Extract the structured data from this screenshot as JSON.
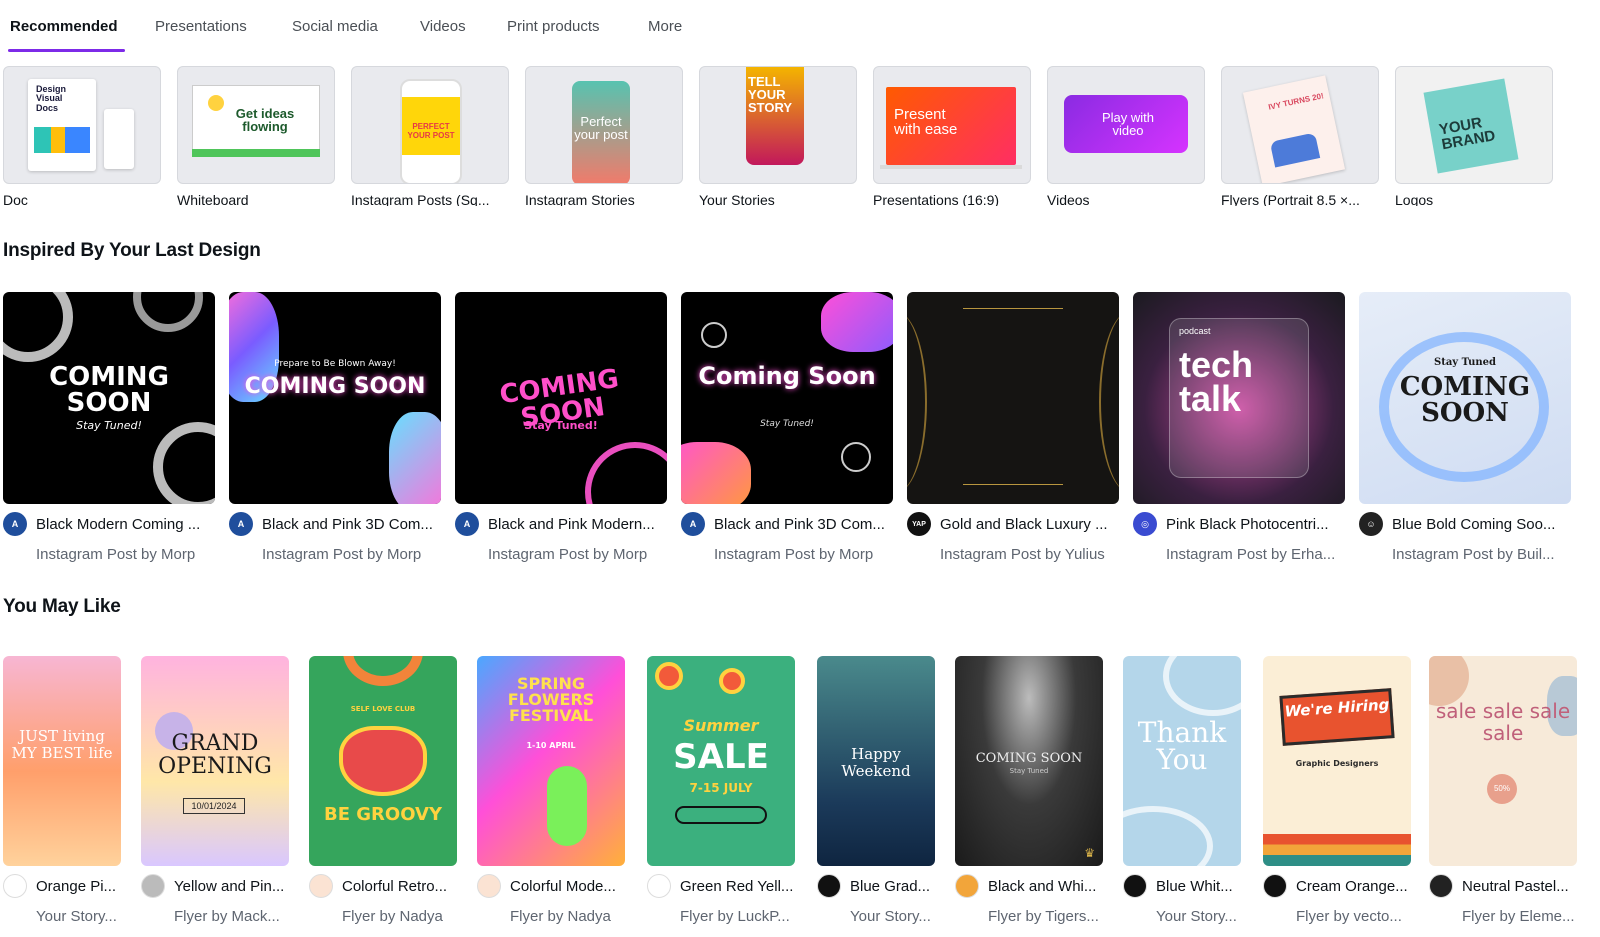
{
  "tabs": [
    {
      "label": "Recommended",
      "active": true
    },
    {
      "label": "Presentations"
    },
    {
      "label": "Social media"
    },
    {
      "label": "Videos"
    },
    {
      "label": "Print products"
    },
    {
      "label": "More"
    }
  ],
  "design_types": [
    {
      "label": "Doc",
      "thumb_text": "Design Visual Docs"
    },
    {
      "label": "Whiteboard",
      "thumb_text": "Get ideas flowing"
    },
    {
      "label": "Instagram Posts (Sq...",
      "thumb_text": "PERFECT YOUR POST"
    },
    {
      "label": "Instagram Stories",
      "thumb_text": "Perfect your post"
    },
    {
      "label": "Your Stories",
      "thumb_text": "TELL YOUR STORY"
    },
    {
      "label": "Presentations (16:9)",
      "thumb_text": "Present with ease"
    },
    {
      "label": "Videos",
      "thumb_text": "Play with video"
    },
    {
      "label": "Flyers (Portrait 8.5 ×...",
      "thumb_text": "IVY TURNS 20!"
    },
    {
      "label": "Logos",
      "thumb_text": "YOUR BRAND"
    }
  ],
  "inspired": {
    "title": "Inspired By Your Last Design",
    "items": [
      {
        "title": "Black Modern Coming ...",
        "sub": "Instagram Post by Morp",
        "thumb_text": "COMING SOON",
        "thumb_sub": "Stay Tuned!",
        "avatar": "A",
        "avatar_color": "#1f4e9c"
      },
      {
        "title": "Black and Pink 3D Com...",
        "sub": "Instagram Post by Morp",
        "thumb_text": "COMING SOON",
        "thumb_sub": "Prepare to Be Blown Away!",
        "avatar": "A",
        "avatar_color": "#1f4e9c"
      },
      {
        "title": "Black and Pink Modern...",
        "sub": "Instagram Post by Morp",
        "thumb_text": "COMING SOON",
        "thumb_sub": "Stay Tuned!",
        "avatar": "A",
        "avatar_color": "#1f4e9c"
      },
      {
        "title": "Black and Pink 3D Com...",
        "sub": "Instagram Post by Morp",
        "thumb_text": "Coming Soon",
        "thumb_sub": "Stay Tuned!",
        "avatar": "A",
        "avatar_color": "#1f4e9c"
      },
      {
        "title": "Gold and Black Luxury ...",
        "sub": "Instagram Post by Yulius",
        "thumb_text": "",
        "thumb_sub": "",
        "avatar": "YAP",
        "avatar_color": "#111111"
      },
      {
        "title": "Pink Black Photocentri...",
        "sub": "Instagram Post by Erha...",
        "thumb_text": "tech talk",
        "thumb_sub": "podcast",
        "avatar": "◎",
        "avatar_color": "#3a4bd1"
      },
      {
        "title": "Blue Bold Coming Soo...",
        "sub": "Instagram Post by Buil...",
        "thumb_text": "COMING SOON",
        "thumb_sub": "Stay Tuned",
        "avatar": "☺",
        "avatar_color": "#222222"
      }
    ]
  },
  "may_like": {
    "title": "You May Like",
    "items": [
      {
        "title": "Orange Pi...",
        "sub": "Your Story...",
        "thumb_text": "JUST living MY BEST life"
      },
      {
        "title": "Yellow and Pin...",
        "sub": "Flyer by Mack...",
        "thumb_text": "GRAND OPENING",
        "thumb_sub": "10/01/2024"
      },
      {
        "title": "Colorful Retro...",
        "sub": "Flyer by Nadya",
        "thumb_text": "BE GROOVY",
        "thumb_sub": "SELF LOVE CLUB"
      },
      {
        "title": "Colorful Mode...",
        "sub": "Flyer by Nadya",
        "thumb_text": "SPRING FLOWERS FESTIVAL",
        "thumb_sub": "1-10 APRIL"
      },
      {
        "title": "Green Red Yell...",
        "sub": "Flyer by LuckP...",
        "thumb_text": "SALE",
        "thumb_sub": "7-15 JULY"
      },
      {
        "title": "Blue Grad...",
        "sub": "Your Story...",
        "thumb_text": "Happy Weekend"
      },
      {
        "title": "Black and Whi...",
        "sub": "Flyer by Tigers...",
        "thumb_text": "COMING SOON",
        "thumb_sub": "Stay Tuned"
      },
      {
        "title": "Blue Whit...",
        "sub": "Your Story...",
        "thumb_text": "Thank You"
      },
      {
        "title": "Cream Orange...",
        "sub": "Flyer by vecto...",
        "thumb_text": "We're Hiring",
        "thumb_sub": "Graphic Designers"
      },
      {
        "title": "Neutral Pastel...",
        "sub": "Flyer by Eleme...",
        "thumb_text": "sale sale sale sale",
        "thumb_sub": "50%"
      }
    ]
  },
  "colors": {
    "accent": "#7d2ae8",
    "text": "#0e1318",
    "muted": "#5e6570"
  }
}
